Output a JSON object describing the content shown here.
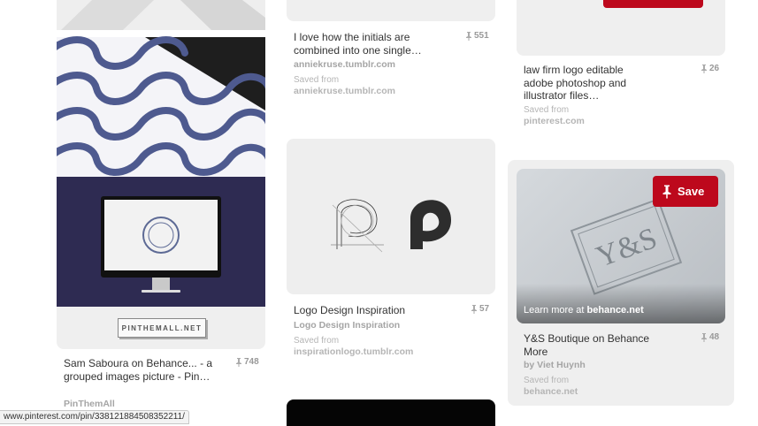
{
  "pins": {
    "sam": {
      "title": "Sam Saboura on Behance... - a grouped images picture - Pin…",
      "count": "748",
      "source": "PinThemAll",
      "watermark": "PINTHEMALL.NET"
    },
    "initials": {
      "title": "I love how the initials are combined into one single…",
      "count": "551",
      "source": "anniekruse.tumblr.com",
      "saved_label": "Saved from",
      "saved_source": "anniekruse.tumblr.com"
    },
    "lawfirm": {
      "title": "law firm logo editable adobe photoshop and illustrator files…",
      "count": "26",
      "saved_label": "Saved from",
      "saved_source": "pinterest.com"
    },
    "logo": {
      "title": "Logo Design Inspiration",
      "count": "57",
      "source": "Logo Design Inspiration",
      "saved_label": "Saved from",
      "saved_source": "inspirationlogo.tumblr.com"
    },
    "ys": {
      "save_label": "Save",
      "learn_prefix": "Learn more at ",
      "learn_site": "behance.net",
      "title": "Y&S Boutique on Behance More",
      "count": "48",
      "attribution": "by Viet Huynh",
      "saved_label": "Saved from",
      "saved_source": "behance.net"
    }
  },
  "status_url": "www.pinterest.com/pin/338121884508352211/",
  "colors": {
    "save_red": "#bd081c",
    "muted": "#a5a5a5"
  }
}
